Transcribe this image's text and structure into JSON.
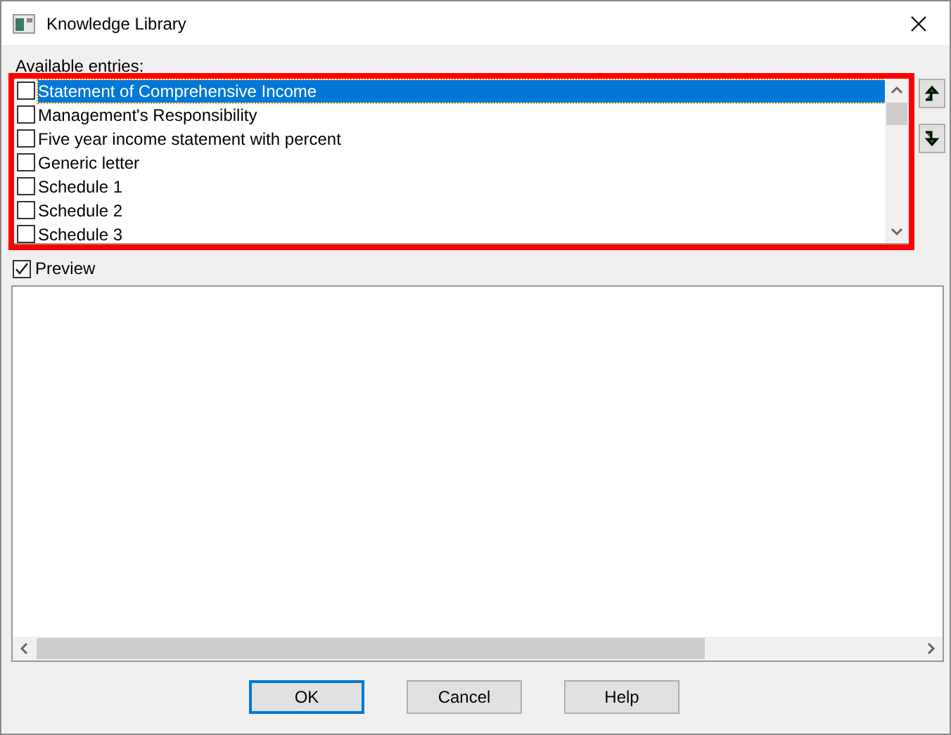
{
  "window": {
    "title": "Knowledge Library"
  },
  "entries_label": "Available entries:",
  "entries": [
    {
      "label": "Statement of Comprehensive Income",
      "checked": false,
      "selected": true
    },
    {
      "label": "Management's Responsibility",
      "checked": false,
      "selected": false
    },
    {
      "label": "Five year income statement with percent",
      "checked": false,
      "selected": false
    },
    {
      "label": "Generic letter",
      "checked": false,
      "selected": false
    },
    {
      "label": "Schedule 1",
      "checked": false,
      "selected": false
    },
    {
      "label": "Schedule 2",
      "checked": false,
      "selected": false
    },
    {
      "label": "Schedule 3",
      "checked": false,
      "selected": false
    }
  ],
  "preview": {
    "label": "Preview",
    "checked": true
  },
  "buttons": [
    {
      "label": "OK",
      "default": true
    },
    {
      "label": "Cancel",
      "default": false
    },
    {
      "label": "Help",
      "default": false
    }
  ]
}
